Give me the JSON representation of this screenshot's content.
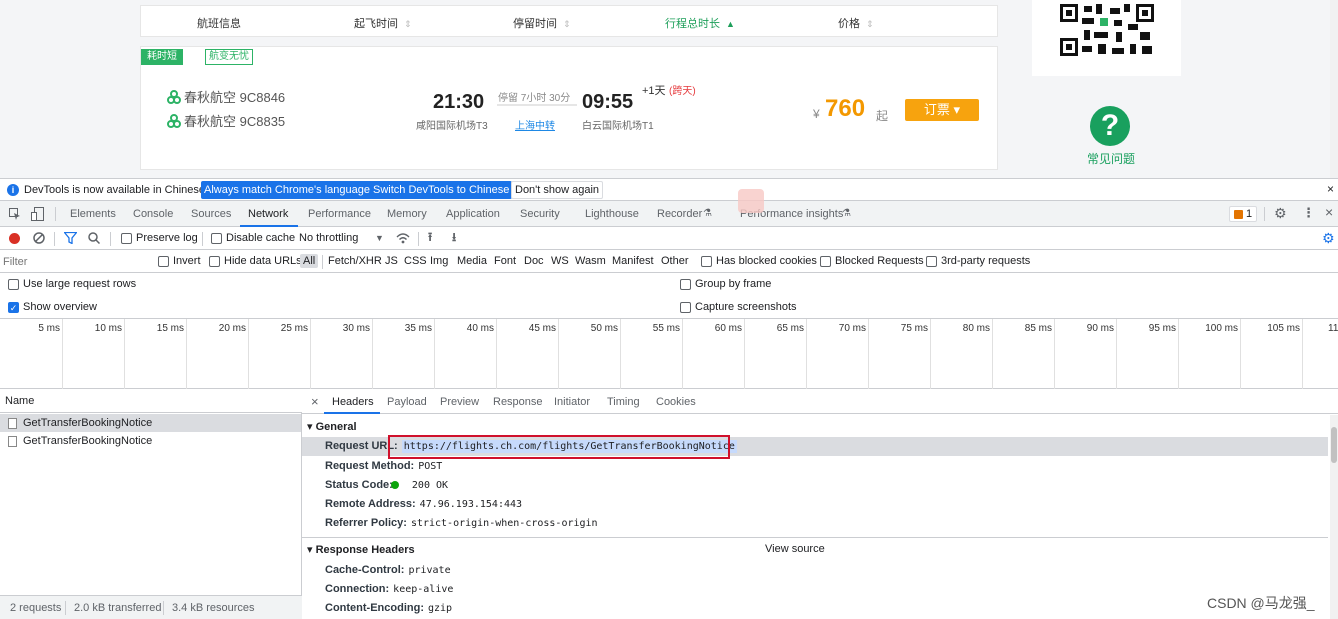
{
  "site": {
    "sort_headers": [
      "航班信息",
      "起飞时间",
      "停留时间",
      "行程总时长",
      "价格"
    ],
    "tags": [
      "耗时短",
      "航变无忧"
    ],
    "airlines": [
      "春秋航空 9C8846",
      "春秋航空 9C8835"
    ],
    "depart_time": "21:30",
    "depart_airport": "咸阳国际机场T3",
    "stop_text": "停留 7小时 30分",
    "stop_city": "上海中转",
    "arrive_time": "09:55",
    "day_offset": "+1天",
    "day_offset_note": "(跨天)",
    "arrive_airport": "白云国际机场T1",
    "currency": "¥",
    "price": "760",
    "price_suffix": "起",
    "book_label": "订票",
    "help_label": "常见问题",
    "brand_color": "#2db366",
    "price_color": "#f39800"
  },
  "devtools": {
    "infobar": {
      "message": "DevTools is now available in Chinese!",
      "btn_match": "Always match Chrome's language",
      "btn_switch": "Switch DevTools to Chinese",
      "btn_dont": "Don't show again",
      "close": "×"
    },
    "tabs": [
      "Elements",
      "Console",
      "Sources",
      "Network",
      "Performance",
      "Memory",
      "Application",
      "Security",
      "Lighthouse",
      "Recorder",
      "Performance insights"
    ],
    "active_tab": "Network",
    "issues_badge": "1",
    "toolbar": {
      "preserve_log": "Preserve log",
      "disable_cache": "Disable cache",
      "throttling": "No throttling"
    },
    "filter": {
      "placeholder": "Filter",
      "invert": "Invert",
      "hide_data_urls": "Hide data URLs",
      "types": [
        "All",
        "Fetch/XHR",
        "JS",
        "CSS",
        "Img",
        "Media",
        "Font",
        "Doc",
        "WS",
        "Wasm",
        "Manifest",
        "Other"
      ],
      "has_blocked_cookies": "Has blocked cookies",
      "blocked_requests": "Blocked Requests",
      "third_party": "3rd-party requests"
    },
    "settings": {
      "large_rows": "Use large request rows",
      "show_overview": "Show overview",
      "group_by_frame": "Group by frame",
      "capture_screenshots": "Capture screenshots"
    },
    "timeline_ticks": [
      "5 ms",
      "10 ms",
      "15 ms",
      "20 ms",
      "25 ms",
      "30 ms",
      "35 ms",
      "40 ms",
      "45 ms",
      "50 ms",
      "55 ms",
      "60 ms",
      "65 ms",
      "70 ms",
      "75 ms",
      "80 ms",
      "85 ms",
      "90 ms",
      "95 ms",
      "100 ms",
      "105 ms",
      "11"
    ],
    "requests": {
      "column_name": "Name",
      "items": [
        "GetTransferBookingNotice",
        "GetTransferBookingNotice"
      ],
      "status": [
        "2 requests",
        "2.0 kB transferred",
        "3.4 kB resources"
      ]
    },
    "detail": {
      "close": "×",
      "tabs": [
        "Headers",
        "Payload",
        "Preview",
        "Response",
        "Initiator",
        "Timing",
        "Cookies"
      ],
      "general_title": "General",
      "general": [
        {
          "k": "Request URL:",
          "v": "https://flights.ch.com/flights/GetTransferBookingNotice"
        },
        {
          "k": "Request Method:",
          "v": "POST"
        },
        {
          "k": "Status Code:",
          "v": "200 OK"
        },
        {
          "k": "Remote Address:",
          "v": "47.96.193.154:443"
        },
        {
          "k": "Referrer Policy:",
          "v": "strict-origin-when-cross-origin"
        }
      ],
      "response_title": "Response Headers",
      "view_source": "View source",
      "response": [
        {
          "k": "Cache-Control:",
          "v": "private"
        },
        {
          "k": "Connection:",
          "v": "keep-alive"
        },
        {
          "k": "Content-Encoding:",
          "v": "gzip"
        }
      ]
    }
  },
  "watermark": "CSDN @马龙强_"
}
